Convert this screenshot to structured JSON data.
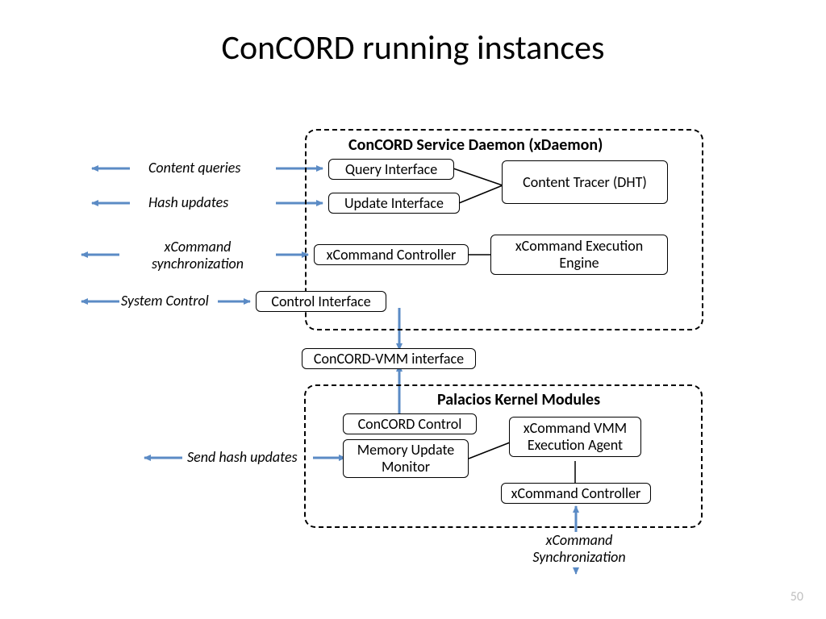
{
  "title": "ConCORD running instances",
  "slide_number": "50",
  "groups": {
    "daemon": {
      "title": "ConCORD Service Daemon (xDaemon)"
    },
    "palacios": {
      "title": "Palacios Kernel Modules"
    }
  },
  "boxes": {
    "query_interface": "Query Interface",
    "update_interface": "Update Interface",
    "xcommand_controller": "xCommand Controller",
    "control_interface": "Control Interface",
    "content_tracer": "Content Tracer (DHT)",
    "xcommand_engine": "xCommand Execution Engine",
    "vmm_interface": "ConCORD-VMM interface",
    "concord_control": "ConCORD Control",
    "memory_monitor": "Memory Update Monitor",
    "xcommand_vmm_agent": "xCommand VMM Execution Agent",
    "xcommand_controller2": "xCommand Controller"
  },
  "labels": {
    "content_queries": "Content queries",
    "hash_updates": "Hash updates",
    "xcommand_sync": "xCommand synchronization",
    "system_control": "System Control",
    "send_hash_updates": "Send hash updates",
    "xcommand_sync2": "xCommand Synchronization"
  }
}
